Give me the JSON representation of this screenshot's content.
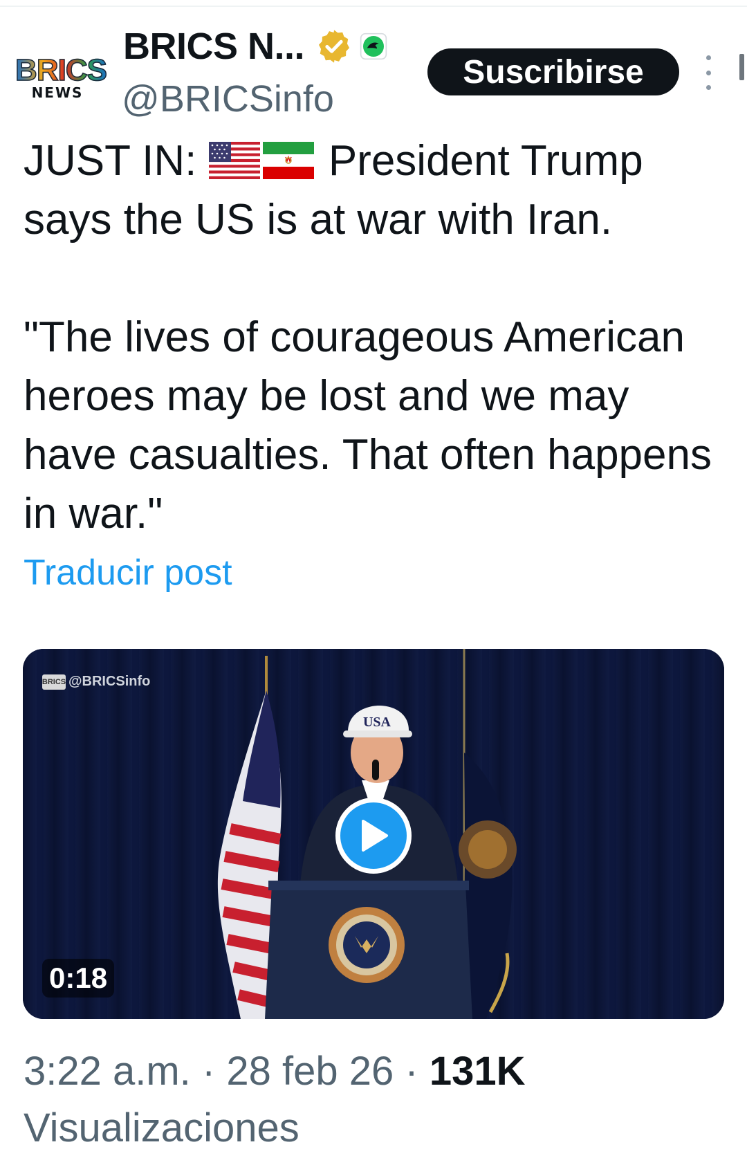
{
  "author": {
    "display_name": "BRICS N...",
    "handle": "@BRICSinfo",
    "avatar_logo_top": "BRICS",
    "avatar_logo_bottom": "NEWS",
    "verified_badge": "gold-check-icon",
    "affiliate_badge": "green-bird-icon"
  },
  "actions": {
    "subscribe_label": "Suscribirse",
    "more_icon": "vertical-dots-icon"
  },
  "post": {
    "line1_prefix": "JUST IN:",
    "flags": [
      "us-flag-icon",
      "iran-flag-icon"
    ],
    "line1_suffix": "President Trump says the US is at war with Iran.",
    "quote": "\"The lives of courageous American heroes may be lost and we may have casualties. That often happens in war.\"",
    "translate_label": "Traducir post"
  },
  "video": {
    "watermark_logo": "BRICS",
    "watermark": "@BRICSinfo",
    "cap_text": "USA",
    "duration": "0:18",
    "play_icon": "play-icon"
  },
  "meta": {
    "time": "3:22 a.m.",
    "date": "28 feb 26",
    "views_count": "131K",
    "views_label": "Visualizaciones",
    "separator": "·"
  },
  "colors": {
    "link": "#1d9bf0",
    "secondary_text": "#536471",
    "primary_text": "#0f1419",
    "button_bg": "#0f1419"
  }
}
